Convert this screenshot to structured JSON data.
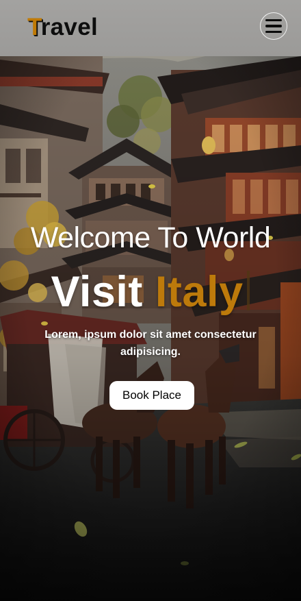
{
  "header": {
    "logo_first_letter": "T",
    "logo_rest": "ravel",
    "menu_icon": "hamburger-menu-icon"
  },
  "hero": {
    "welcome_text": "Welcome To World",
    "visit_word": "Visit",
    "visit_place": "Italy",
    "subtitle": "Lorem, ipsum dolor sit amet consectetur adipisicing.",
    "cta_label": "Book Place",
    "background_image": "painted street scene with pagoda buildings and horse-drawn carriage"
  },
  "colors": {
    "accent": "#bd7a0b",
    "header_bg": "#a3a2a0",
    "text_light": "#ffffff",
    "text_dark": "#0d0d0d"
  }
}
